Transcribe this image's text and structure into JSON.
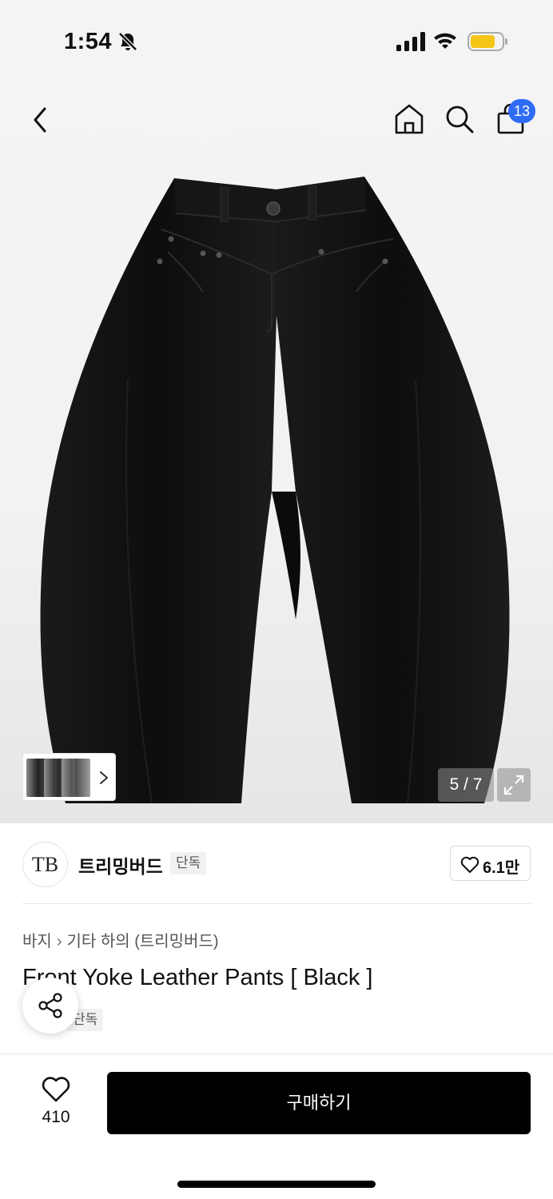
{
  "status_bar": {
    "time": "1:54",
    "icons": [
      "bell-slash-icon",
      "signal-icon",
      "wifi-icon",
      "battery-icon"
    ],
    "battery_color": "#f5c518"
  },
  "nav": {
    "icons": [
      "back-icon",
      "home-icon",
      "search-icon",
      "shopping-bag-icon"
    ],
    "cart_badge": "13",
    "badge_color": "#2e6cf6"
  },
  "gallery": {
    "counter": "5 / 7",
    "icons": [
      "chevron-right-icon",
      "expand-icon"
    ]
  },
  "brand": {
    "logo_text": "TB",
    "name": "트리밍버드",
    "tag": "단독",
    "likes": "6.1만"
  },
  "product": {
    "breadcrumb": [
      "바지",
      "기타 하의 (트리밍버드)"
    ],
    "title": "Front Yoke Leather Pants [ Black ]",
    "tag": "단독"
  },
  "bottom_bar": {
    "wish_count": "410",
    "buy_label": "구매하기"
  }
}
